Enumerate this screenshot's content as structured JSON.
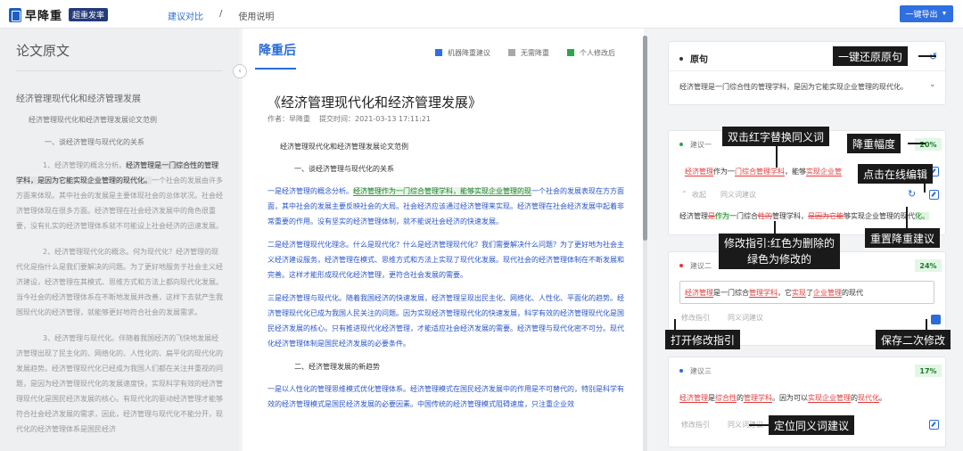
{
  "header": {
    "brand": "早降重",
    "badge": "超重发率",
    "nav": {
      "compare": "建议对比",
      "sep": "/",
      "help": "使用说明"
    },
    "export_label": "一键导出",
    "export_caret": "▼"
  },
  "left": {
    "heading": "论文原文",
    "title": "经济管理现代化和经济管理发展",
    "subtitle": "经济管理现代化和经济管理发展论文范例",
    "section1": "一、谈经济管理与现代化的关系",
    "p1_lead": "1、经济管理的概念分析。",
    "p1_hl": "经济管理是一门综合性的管理学科，是因为它能实现企业管理的现代化。",
    "p1_rest": "一个社会的发展由许多方面来体现。其中社会的发展是主要体现社会的总体状况。社会经济管理体现在很多方面。经济管理在社会经济发展中的角色很重要，没有扎实的经济管理体系就不可能设上社会经济的迅速发展。",
    "p2": "2、经济管理现代化的概念。何为现代化？经济管理的现代化是指什么是我们要解决的问题。为了更好地服务于社会主义经济建设，经济管理在其模式、思维方式和方法上都向现代化发展。当今社会的经济管理体系在不断地发展并改善，这样下去就产生我国现代化的经济管理，就能够更好地符合社会的发展需求。",
    "p3": "3、经济管理与现代化。伴随着我国经济的飞快地发展经济管理出现了民主化的、网络化的、人性化的、扁平化的现代化的发展趋势。经济管理现代化已经成为我国人们都在关注并重视的问题，是因为经济管理现代化的发展速度快，实现科学有效的经济管理现代化是国民经济发展的核心。有现代化的驱动经济管理才能够符合社会经济发展的需求，因此，经济管理与现代化不能分开，现代化的经济管理体系是国民经济"
  },
  "middle": {
    "heading": "降重后",
    "legend": [
      {
        "label": "机器降重建议",
        "color": "#2f6fe0"
      },
      {
        "label": "无需降重",
        "color": "#a8a8a8"
      },
      {
        "label": "个人修改后",
        "color": "#2da44e"
      }
    ],
    "doc_title": "《经济管理现代化和经济管理发展》",
    "author": "作者：早降重",
    "submit_time": "提交时间：2021-03-13 17:11:21",
    "subtitle": "经济管理现代化和经济管理发展论文范例",
    "section1": "一、谈经济管理与现代化的关系",
    "p1_lead": "一是经济管理的概念分析。",
    "p1_green": "经济管理作为一门综合管理学科，能够实现企业管理的现",
    "p1_rest": "一个社会的发展表现在方方面面，其中社会的发展主要反映社会的大局。社会经济应该通过经济管理来实现。经济管理在社会经济发展中起着非常重要的作用。没有坚实的经济管理体制，就不能说社会经济的快速发展。",
    "p2": "二是经济管理现代化理念。什么是现代化？什么是经济管理现代化？我们需要解决什么问题？为了更好地为社会主义经济建设服务，经济管理在模式、思维方式和方法上实现了现代化发展。现代社会的经济管理体制在不断发展和完善。这样才能形成现代化经济管理，更符合社会发展的需要。",
    "p3": "三是经济管理与现代化。随着我国经济的快速发展，经济管理呈现出民主化、网络化、人性化、平面化的趋势。经济管理现代化已成为我国人民关注的问题。因为实现经济管理现代化的快速发展，科学有效的经济管理现代化是国民经济发展的核心。只有推进现代化经济管理，才能适应社会经济发展的需要。经济管理与现代化密不可分。现代化经济管理体制是国民经济发展的必要条件。",
    "section2": "二、经济管理发展的新趋势",
    "p4": "一是以人性化的管理思维模式优化管理体系。经济管理模式在国民经济发展中的作用是不可替代的，特别是科学有效的经济管理模式是国民经济发展的必要因素。中国传统的经济管理模式阻碍速度，只注重企业效"
  },
  "right": {
    "orig_title": "原句",
    "orig_text": "经济管理是一门综合性的管理学科，是因为它能实现企业管理的现代化。",
    "s1": {
      "label": "建议一",
      "pct": "20%",
      "t_a": "经济管理",
      "t_b": "作为一",
      "t_c": "门综合",
      "t_d": "管理学科",
      "t_e": "，能够",
      "t_f": "实现企业管",
      "collapse": "收起",
      "synonym": "同义词建议",
      "m_a": "经济管理",
      "m_b": "是",
      "m_c": "作为",
      "m_d": "一门综合",
      "m_e": "性的",
      "m_f": "管理学科，",
      "m_g": "是因为它能",
      "m_h": "够实现企业管理的现代",
      "m_i": "化。"
    },
    "s2": {
      "label": "建议二",
      "pct": "24%",
      "t_a": "经济管理",
      "t_b": "是一门综合",
      "t_c": "管理学科",
      "t_d": "，它",
      "t_e": "实现",
      "t_f": "了",
      "t_g": "企业管理",
      "t_h": "的现代",
      "guide": "修改指引",
      "synonym": "同义词建议"
    },
    "s3": {
      "label": "建议三",
      "pct": "17%",
      "t_a": "经济管理",
      "t_b": "是",
      "t_c": "综合性",
      "t_d": "的",
      "t_e": "管理学科",
      "t_f": "。因为可以",
      "t_g": "实现企业管理",
      "t_h": "的",
      "t_i": "现代化",
      "t_j": "。",
      "guide": "修改指引",
      "synonym": "同义词建议"
    }
  },
  "callouts": {
    "restore": "一键还原原句",
    "dblclick": "双击红字替换同义词",
    "rate": "降重幅度",
    "online_edit": "点击在线编辑",
    "reset": "重置降重建议",
    "guide_l1": "修改指引:红色为删除的",
    "guide_l2": "绿色为修改的",
    "open_guide": "打开修改指引",
    "save": "保存二次修改",
    "locate": "定位同义词建议"
  },
  "icons": {
    "undo": "↺",
    "chevron": "⌄",
    "reset": "↻",
    "collapse_arrow": "‹",
    "fold": "⌃"
  }
}
